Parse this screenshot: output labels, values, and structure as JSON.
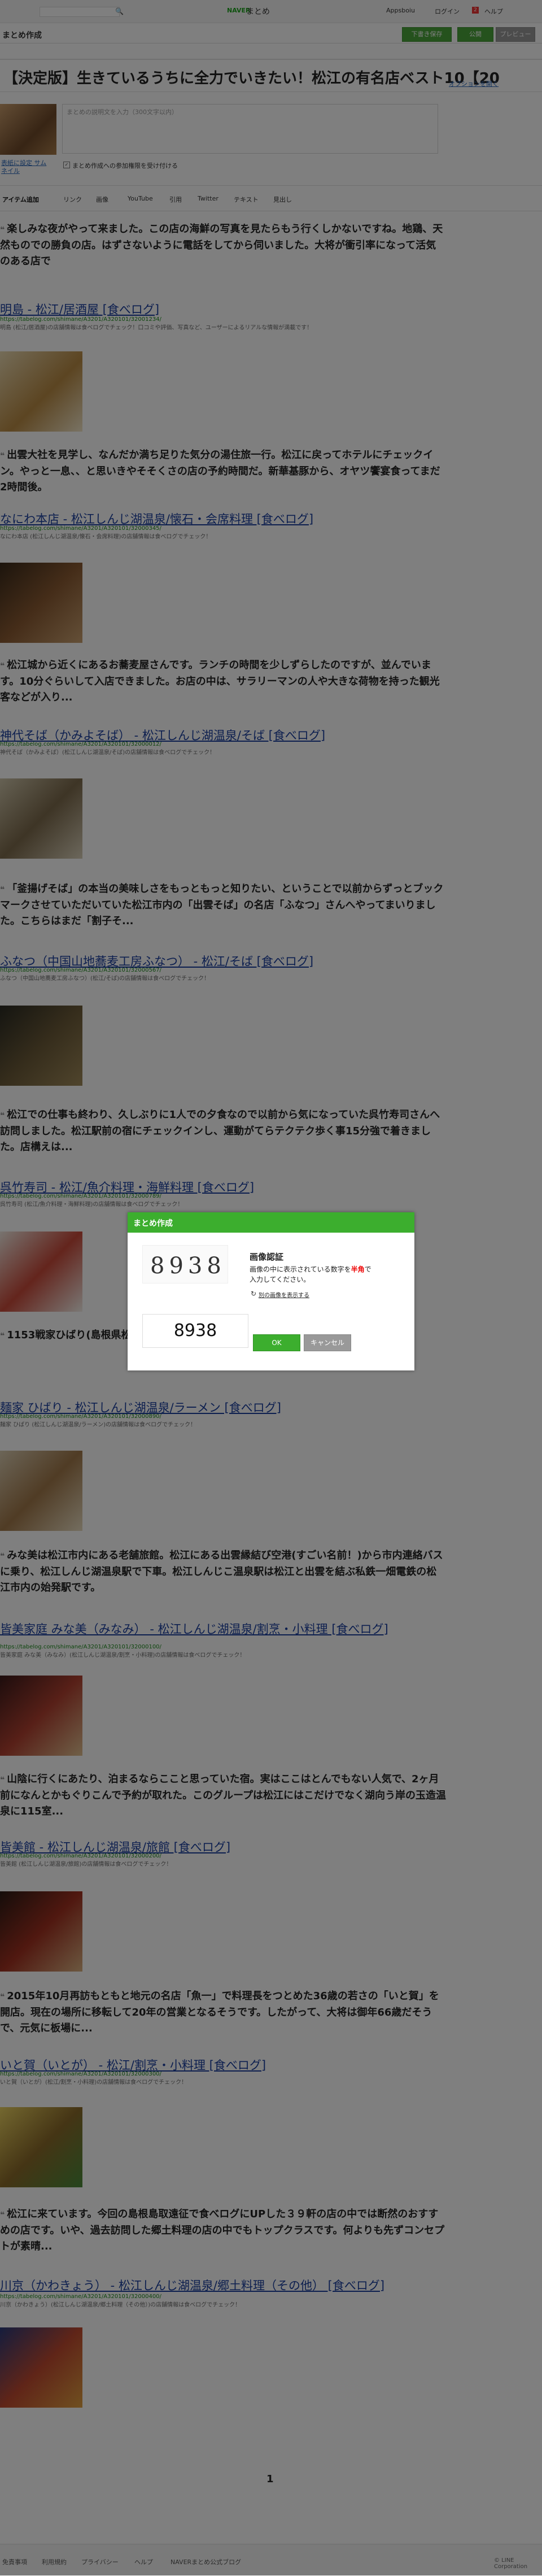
{
  "header": {
    "search_placeholder": "",
    "naver_label": "NAVER",
    "matome_label": "まとめ",
    "apps_label": "Appsboiu",
    "login_label": "ログイン",
    "notif_count": "2",
    "help_label": "ヘルプ"
  },
  "subbar": {
    "title": "まとめ作成",
    "download_label": "下書き保存",
    "publish_label": "公開",
    "save_label": "プレビュー"
  },
  "editor": {
    "title_value": "【決定版】生きているうちに全力でいきたい！松江の有名店ベスト10【20",
    "options_label": "オプションを開く",
    "thumbnail_label": "表紙に設定 サムネイル",
    "description_placeholder": "まとめの説明文を入力（300文字以内）",
    "allow_label": "まとめ作成への参加権限を受け付ける"
  },
  "toolbar": {
    "items": [
      "アイテム追加",
      "リンク",
      "画像",
      "YouTube",
      "引用",
      "Twitter",
      "テキスト",
      "見出し"
    ]
  },
  "entries": [
    {
      "quote": "楽しみな夜がやって来ました。この店の海鮮の写真を見たらもう行くしかないですね。地鶏、天然ものでの勝負の店。はずさないように電話をしてから伺いました。大将が衝引率になって活気のある店で",
      "title": "明島 - 松江/居酒屋 [食べログ]",
      "url": "https://tabelog.com/shimane/A3201/A320101/32001234/",
      "desc": "明島 (松江/居酒屋)の店舗情報は食べログでチェック！口コミや評価、写真など、ユーザーによるリアルな情報が満載です！"
    },
    {
      "quote": "出雲大社を見学し、なんだか満ち足りた気分の湯住旅一行。松江に戻ってホテルにチェックイン。やっと一息、、と思いきやそそくさの店の予約時間だ。新華基豚から、オヤツ饗宴食ってまだ2時間後。",
      "title": "なにわ本店 - 松江しんじ湖温泉/懐石・会席料理 [食べログ]",
      "url": "https://tabelog.com/shimane/A3201/A320101/32000345/",
      "desc": "なにわ本店 (松江しんじ湖温泉/懐石・会席料理)の店舗情報は食べログでチェック！"
    },
    {
      "quote": "松江城から近くにあるお蕎麦屋さんです。ランチの時間を少しずらしたのですが、並んでいます。10分ぐらいして入店できました。お店の中は、サラリーマンの人や大きな荷物を持った観光客などが入り...",
      "title": "神代そば（かみよそば） - 松江しんじ湖温泉/そば [食べログ]",
      "url": "https://tabelog.com/shimane/A3201/A320101/32000012/",
      "desc": "神代そば（かみよそば）(松江しんじ湖温泉/そば)の店舗情報は食べログでチェック！"
    },
    {
      "quote": "「釜揚げそば」の本当の美味しさをもっともっと知りたい、ということで以前からずっとブックマークさせていただいていた松江市内の「出雲そば」の名店「ふなつ」さんへやってまいりました。こちらはまだ「割子そ...",
      "title": "ふなつ（中国山地蕎麦工房ふなつ） - 松江/そば [食べログ]",
      "url": "https://tabelog.com/shimane/A3201/A320101/32000567/",
      "desc": "ふなつ（中国山地蕎麦工房ふなつ）(松江/そば)の店舗情報は食べログでチェック！"
    },
    {
      "quote": "松江での仕事も終わり、久しぶりに1人での夕食なので以前から気になっていた呉竹寿司さんへ訪問しました。松江駅前の宿にチェックインし、運動がてらテクテク歩く事15分強で着きました。店構えは...",
      "title": "呉竹寿司 - 松江/魚介料理・海鮮料理 [食べログ]",
      "url": "https://tabelog.com/shimane/A3201/A320101/32000789/",
      "desc": "呉竹寿司 (松江/魚介料理・海鮮料理)の店舗情報は食べログでチェック！"
    },
    {
      "quote": "1153戦家ひばり(島根県松江市)2時間のみの営業なのでラーメンランキングでNo...",
      "title": "麺家 ひばり - 松江しんじ湖温泉/ラーメン [食べログ]",
      "url": "https://tabelog.com/shimane/A3201/A320101/32000890/",
      "desc": "麺家 ひばり (松江しんじ湖温泉/ラーメン)の店舗情報は食べログでチェック！"
    },
    {
      "quote": "みな美は松江市内にある老舗旅館。松江にある出雲縁結び空港(すごい名前！)から市内連絡バスに乗り、松江しんじ湖温泉駅で下車。松江しんじこ温泉駅は松江と出雲を結ぶ私鉄一畑電鉄の松江市内の始発駅です。",
      "title": "皆美家庭 みな美（みなみ） - 松江しんじ湖温泉/割烹・小料理 [食べログ]",
      "url": "https://tabelog.com/shimane/A3201/A320101/32000100/",
      "desc": "皆美家庭 みな美（みなみ）(松江しんじ湖温泉/割烹・小料理)の店舗情報は食べログでチェック！"
    },
    {
      "quote": "山陰に行くにあたり、泊まるならここと思っていた宿。実はここはとんでもない人気で、2ヶ月前になんとかもぐりこんで予約が取れた。このグループは松江にはこだけでなく湖向う岸の玉造温泉に115室...",
      "title": "皆美館 - 松江しんじ湖温泉/旅館 [食べログ]",
      "url": "https://tabelog.com/shimane/A3201/A320101/32000200/",
      "desc": "皆美館 (松江しんじ湖温泉/旅館)の店舗情報は食べログでチェック！"
    },
    {
      "quote": "2015年10月再訪もともと地元の名店「魚一」で料理長をつとめた36歳の若さの「いと賀」を開店。現在の場所に移転して20年の営業となるそうです。したがって、大将は御年66歳だそうで、元気に板場に...",
      "title": "いと賀（いとが） - 松江/割烹・小料理 [食べログ]",
      "url": "https://tabelog.com/shimane/A3201/A320101/32000300/",
      "desc": "いと賀（いとが）(松江/割烹・小料理)の店舗情報は食べログでチェック！"
    },
    {
      "quote": "松江に来ています。今回の島根島取遠征で食べログにUPした３９軒の店の中では断然のおすすめの店です。いや、過去訪問した郷土料理の店の中でもトップクラスです。何よりも先ずコンセプトが素晴...",
      "title": "川京（かわきょう） - 松江しんじ湖温泉/郷土料理（その他） [食べログ]",
      "url": "https://tabelog.com/shimane/A3201/A320101/32000400/",
      "desc": "川京（かわきょう）(松江しんじ湖温泉/郷土料理（その他）)の店舗情報は食べログでチェック！"
    }
  ],
  "pager": {
    "current": "1"
  },
  "footer": {
    "links": [
      "免責事項",
      "利用規約",
      "プライバシー",
      "ヘルプ",
      "NAVERまとめ公式ブログ"
    ],
    "copyright": "© LINE Corporation"
  },
  "modal": {
    "title": "まとめ作成",
    "captcha_digits": "8938",
    "heading": "画像認証",
    "instruction_before": "画像の中に表示されている数字を",
    "instruction_em": "半角",
    "instruction_after": "で",
    "instruction_line2": "入力してください。",
    "refresh_label": "別の画像を表示する",
    "input_value": "8938",
    "ok_label": "OK",
    "cancel_label": "キャンセル"
  },
  "colors": {
    "accent": "#3cae2e",
    "link": "#1b3f9e",
    "url": "#1a8a1a"
  }
}
